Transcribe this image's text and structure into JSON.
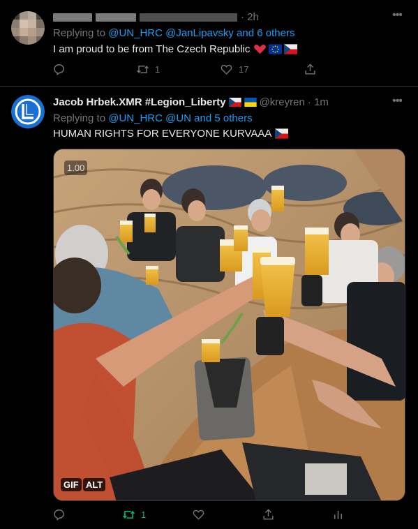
{
  "tweet1": {
    "time": "· 2h",
    "replying_prefix": "Replying to ",
    "replying_to": "@UN_HRC @JanLipavsky and 6 others",
    "text": "I am proud to be from The Czech Republic",
    "emoji": [
      "red-heart",
      "eu-flag",
      "czech-flag"
    ],
    "retweets": "1",
    "likes": "17"
  },
  "tweet2": {
    "name": "Jacob Hrbek.XMR #Legion_Liberty",
    "name_flags": [
      "czech-flag",
      "ukraine-flag"
    ],
    "handle": "@kreyren",
    "time": "· 1m",
    "replying_prefix": "Replying to ",
    "replying_to": "@UN_HRC @UN and 5 others",
    "text": "HUMAN RIGHTS FOR EVERYONE KURVAAA",
    "text_emoji": [
      "czech-flag"
    ],
    "media": {
      "speed": "1.00",
      "gif_label": "GIF",
      "alt_label": "ALT"
    },
    "retweets": "1"
  },
  "colors": {
    "background": "#000000",
    "text": "#e7e9ea",
    "muted": "#71767b",
    "link": "#1d9bf0",
    "retweeted": "#00ba7c",
    "divider": "#2f3336"
  }
}
